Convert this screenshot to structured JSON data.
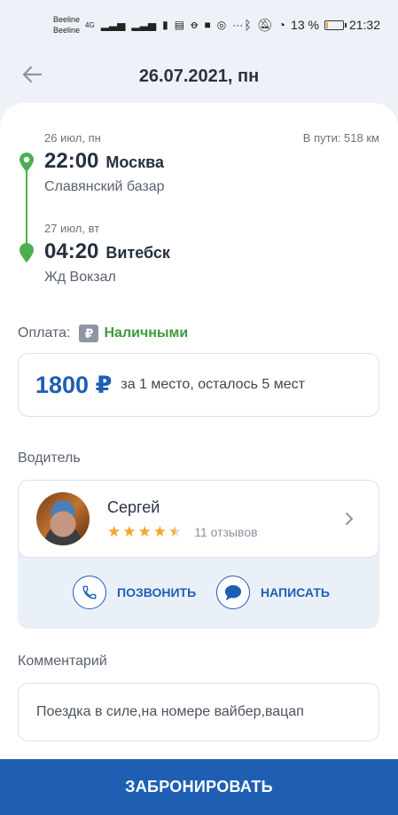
{
  "status_bar": {
    "carrier_1": "Beeline",
    "carrier_2": "Beeline",
    "network": "4G",
    "battery": "13 %",
    "time": "21:32",
    "battery_level": 0.13
  },
  "header": {
    "title": "26.07.2021, пн"
  },
  "trip": {
    "departure": {
      "date": "26 июл, пн",
      "time": "22:00",
      "city": "Москва",
      "place": "Славянский базар"
    },
    "duration": "В пути: 518 км",
    "arrival": {
      "date": "27 июл, вт",
      "time": "04:20",
      "city": "Витебск",
      "place": "Жд Вокзал"
    }
  },
  "payment": {
    "label": "Оплата:",
    "badge": "₽",
    "method": "Наличными"
  },
  "price": {
    "amount": "1800 ₽",
    "note": "за 1 место, осталось 5 мест"
  },
  "driver": {
    "section_label": "Водитель",
    "name": "Сергей",
    "rating": 4.5,
    "rating_max": 5,
    "reviews": "11 отзывов",
    "call_label": "ПОЗВОНИТЬ",
    "message_label": "НАПИСАТЬ"
  },
  "comment": {
    "section_label": "Комментарий",
    "text": "Поездка в силе,на номере вайбер,вацап"
  },
  "book_button": "ЗАБРОНИРОВАТЬ",
  "colors": {
    "accent": "#1e5fb3",
    "green": "#4caf50",
    "star": "#f5a623"
  }
}
